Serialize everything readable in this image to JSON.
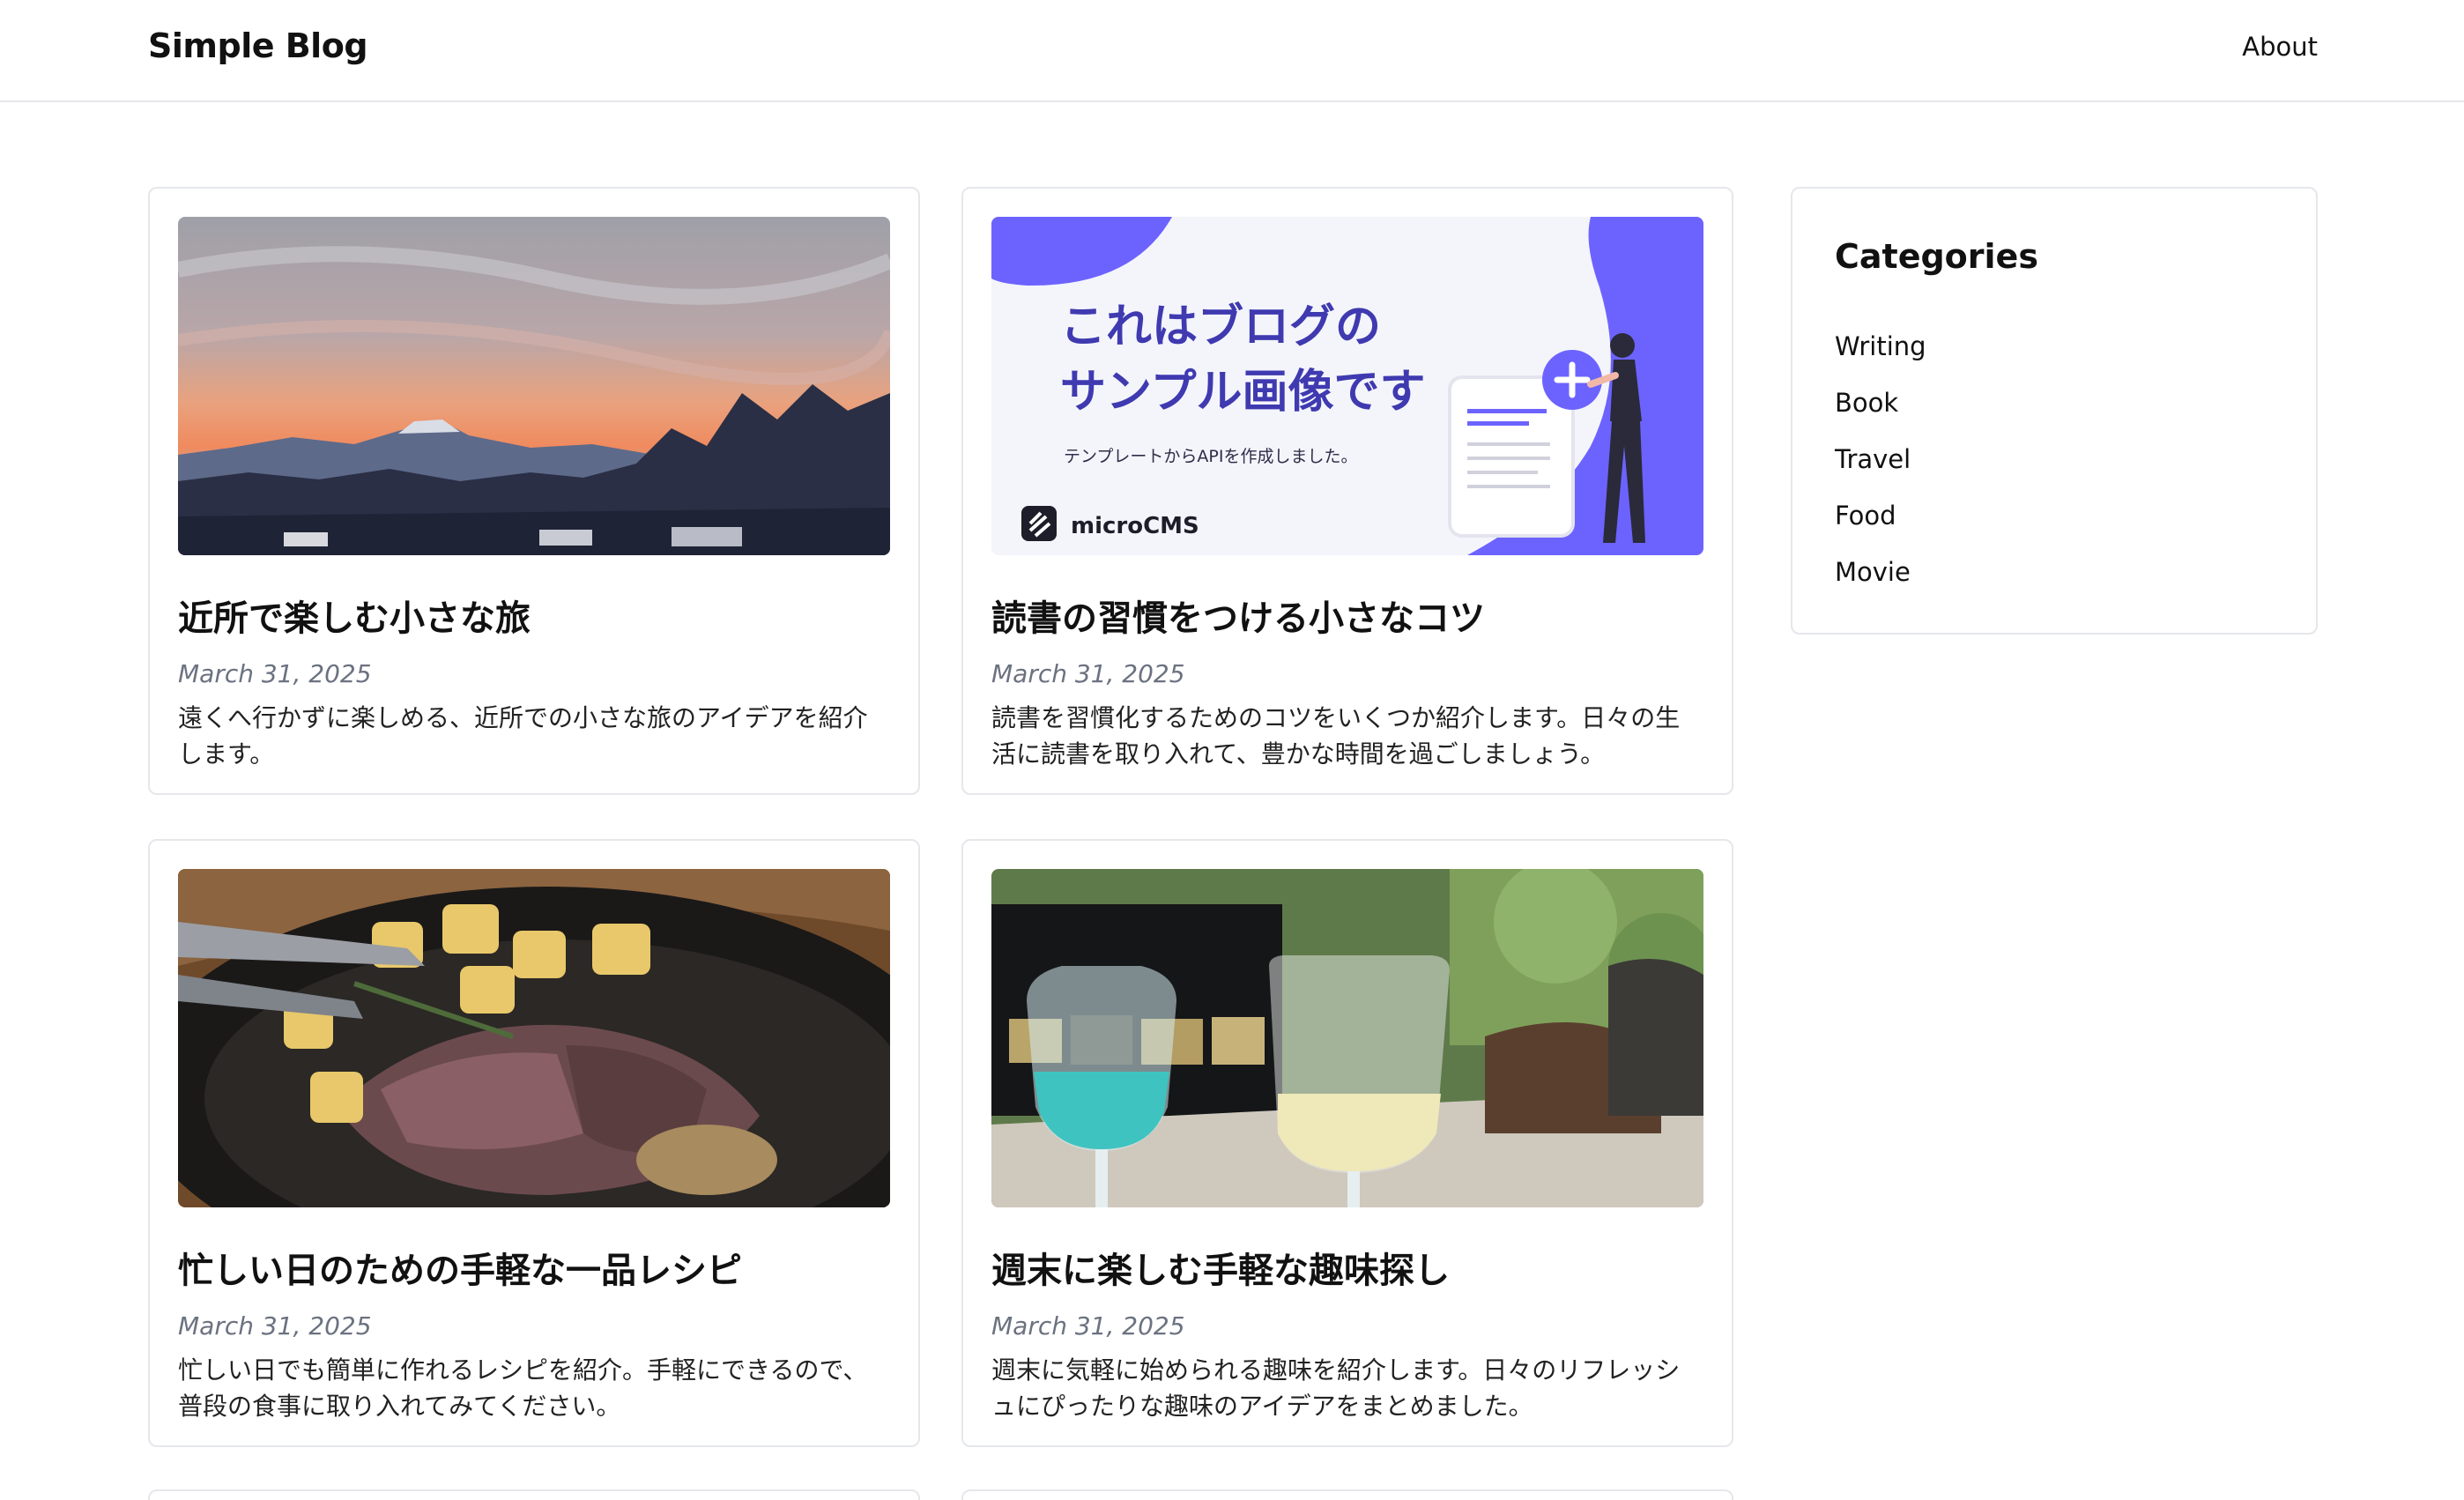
{
  "header": {
    "brand": "Simple Blog",
    "nav": {
      "about": "About"
    }
  },
  "posts": [
    {
      "title": "近所で楽しむ小さな旅",
      "date": "March 31, 2025",
      "excerpt": "遠くへ行かずに楽しめる、近所での小さな旅のアイデアを紹介します。",
      "image": "sunset-mountains-photo"
    },
    {
      "title": "読書の習慣をつける小さなコツ",
      "date": "March 31, 2025",
      "excerpt": "読書を習慣化するためのコツをいくつか紹介します。日々の生活に読書を取り入れて、豊かな時間を過ごしましょう。",
      "image": "microcms-sample-banner",
      "banner": {
        "heading_line1": "これはブログの",
        "heading_line2": "サンプル画像です",
        "subtext": "テンプレートからAPIを作成しました。",
        "logo_text": "microCMS"
      }
    },
    {
      "title": "忙しい日のための手軽な一品レシピ",
      "date": "March 31, 2025",
      "excerpt": "忙しい日でも簡単に作れるレシピを紹介。手軽にできるので、普段の食事に取り入れてみてください。",
      "image": "steak-potatoes-photo"
    },
    {
      "title": "週末に楽しむ手軽な趣味探し",
      "date": "March 31, 2025",
      "excerpt": "週末に気軽に始められる趣味を紹介します。日々のリフレッシュにぴったりな趣味のアイデアをまとめました。",
      "image": "drinks-cafe-photo"
    }
  ],
  "sidebar": {
    "heading": "Categories",
    "categories": [
      "Writing",
      "Book",
      "Travel",
      "Food",
      "Movie"
    ]
  },
  "colors": {
    "accent": "#6c63ff",
    "border": "#e5e7eb",
    "date": "#6b7280"
  }
}
